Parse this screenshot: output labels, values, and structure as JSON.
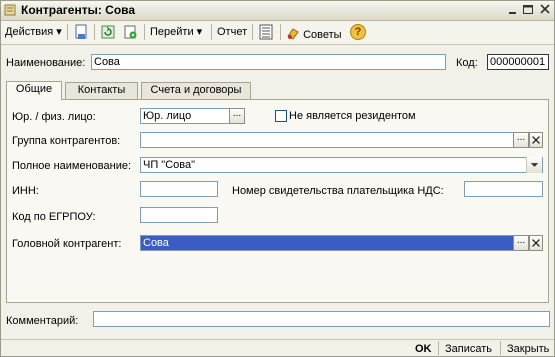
{
  "window": {
    "title": "Контрагенты: Сова"
  },
  "toolbar": {
    "actions_label": "Действия",
    "goto_label": "Перейти",
    "report_label": "Отчет",
    "tips_label": "Советы",
    "help_label": "?"
  },
  "header": {
    "name_label": "Наименование:",
    "name_value": "Сова",
    "code_label": "Код:",
    "code_value": "000000001"
  },
  "tabs": [
    {
      "label": "Общие"
    },
    {
      "label": "Контакты"
    },
    {
      "label": "Счета и договоры"
    }
  ],
  "general": {
    "legal_label": "Юр. / физ. лицо:",
    "legal_value": "Юр. лицо",
    "nonresident_label": "Не является резидентом",
    "nonresident_checked": false,
    "group_label": "Группа контрагентов:",
    "group_value": "",
    "fullname_label": "Полное наименование:",
    "fullname_value": "ЧП \"Сова\"",
    "inn_label": "ИНН:",
    "inn_value": "",
    "vat_label": "Номер свидетельства плательщика НДС:",
    "vat_value": "",
    "egrpou_label": "Код по ЕГРПОУ:",
    "egrpou_value": "",
    "parent_label": "Головной контрагент:",
    "parent_value": "Сова"
  },
  "comment": {
    "label": "Комментарий:",
    "value": ""
  },
  "footer": {
    "ok_label": "OK",
    "save_label": "Записать",
    "close_label": "Закрыть"
  },
  "colors": {
    "selection": "#3b5bc5",
    "field_border": "#7f9db9"
  }
}
